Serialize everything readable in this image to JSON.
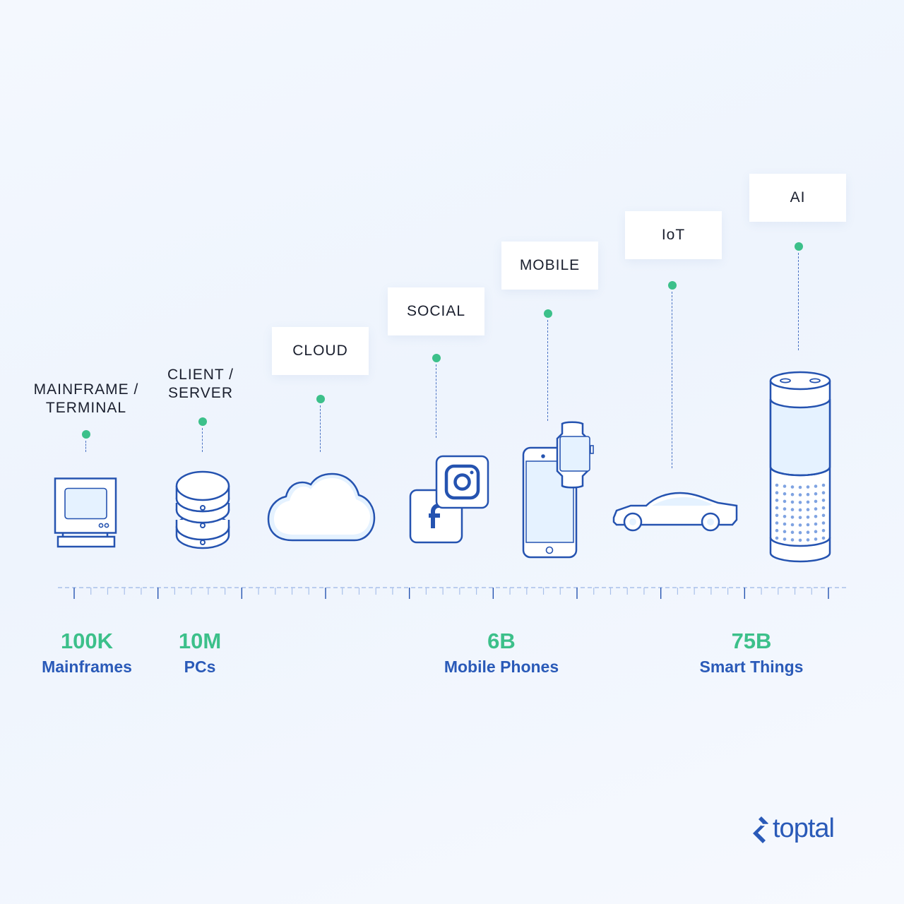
{
  "eras": [
    {
      "label": "MAINFRAME /\nTERMINAL",
      "line1": "MAINFRAME /",
      "line2": "TERMINAL",
      "icon": "mainframe-terminal-icon"
    },
    {
      "label": "CLIENT / SERVER",
      "line1": "CLIENT /",
      "line2": "SERVER",
      "icon": "database-server-icon"
    },
    {
      "label": "CLOUD",
      "icon": "cloud-icon"
    },
    {
      "label": "SOCIAL",
      "icon": "social-media-icon"
    },
    {
      "label": "MOBILE",
      "icon": "phone-watch-icon"
    },
    {
      "label": "IoT",
      "display": "IoT",
      "icon": "car-icon"
    },
    {
      "label": "AI",
      "icon": "smart-speaker-icon"
    }
  ],
  "stats": [
    {
      "value": "100K",
      "label": "Mainframes"
    },
    {
      "value": "10M",
      "label": "PCs"
    },
    {
      "value": "6B",
      "label": "Mobile Phones"
    },
    {
      "value": "75B",
      "label": "Smart Things"
    }
  ],
  "brand": {
    "name": "toptal",
    "logo_icon": "toptal-logo-icon"
  },
  "colors": {
    "accent_green": "#3cc08a",
    "brand_blue": "#2a5ab8",
    "stroke_blue": "#2553b0",
    "fill_light": "#e5f2ff"
  }
}
